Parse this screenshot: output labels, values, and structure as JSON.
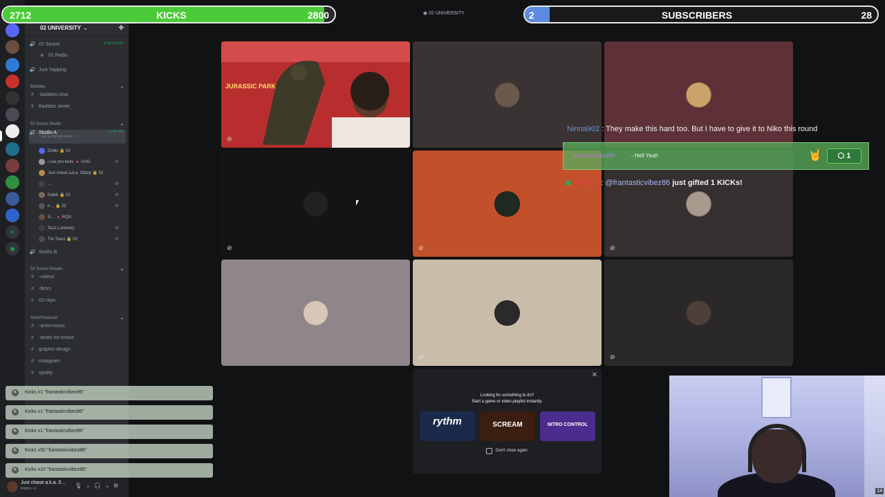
{
  "goals": {
    "kicks": {
      "current": "2712",
      "label": "KICKS",
      "target": "2800",
      "progress": 0.969,
      "color": "#4ccb3a"
    },
    "subscribers": {
      "current": "2",
      "label": "SUBSCRIBERS",
      "target": "28",
      "progress": 0.071,
      "color": "#5b8ae0"
    }
  },
  "window_title": "02 UNIVERSITY",
  "server": {
    "name": "02 UNIVERSITY",
    "channels": [
      {
        "label": "02 Sound",
        "time": "1:92:53:08"
      },
      {
        "label": "02 Radio"
      },
      {
        "label": "Just Yapping"
      }
    ],
    "categories": {
      "baddies": "Baddies",
      "studio": "02 Sound Studio",
      "visuals": "02 Sound Visuals",
      "artist": "Artist/Producer"
    },
    "baddies_channels": [
      "-baddies-chat",
      "Baddies street"
    ],
    "studio_a": {
      "label": "Studio A",
      "time": "1:47:04",
      "status": "Set a channel status"
    },
    "voice_users": [
      "Drells 🔒 02",
      "i use pro tools 🔺 UUG",
      "Just chase a.k.a. 02boy 🔒 02",
      "…",
      "Kaleb 🔒 02",
      "n… 🔒 02",
      "S… 🔺 RQG",
      "Tezz.Luminary",
      "Tre Trenz 🔒 02"
    ],
    "studio_b": "Studio B",
    "visual_channels": [
      "-videos",
      "-flicks",
      "02-clips"
    ],
    "artist_channels": [
      "-artist-music",
      "-beats-for-chase",
      "graphic-design",
      "instagram",
      "spotify"
    ]
  },
  "user_panel": {
    "name": "Just chase a.k.a. 0…",
    "status": "Roblox +1"
  },
  "kick_notifications": [
    "Kicks x1 \"frantasticvibez86\"",
    "Kicks x1 \"frantasticvibez86\"",
    "Kicks x1 \"frantasticvibez86\"",
    "Kicks x50 \"frantasticvibez86\"",
    "Kicks x10 \"frantasticvibez86\""
  ],
  "tiles": [
    {
      "bg": "#c33a3a",
      "scene": "JURASSIC PARK"
    },
    {
      "bg": "#3a3334"
    },
    {
      "bg": "#5d3137"
    },
    {
      "bg": "#141414"
    },
    {
      "bg": "#c2502a"
    },
    {
      "bg": "#35302f"
    },
    {
      "bg": "#8f858b"
    },
    {
      "bg": "#c9bca9"
    },
    {
      "bg": "#2b2829"
    }
  ],
  "chat": {
    "line1_user": "Ninna902",
    "line1_text": " : They make this hard too. But I have to give it to Niko this round",
    "highlight_user": "frantasticvibez86",
    "highlight_text": "- Hell Yeah",
    "highlight_count": "1",
    "line2_bot": "KickBot",
    "line2_user": "@frantasticvibez86",
    "line2_text": "just gifted 1 KICKs!"
  },
  "activity": {
    "title": "Looking for something to do?",
    "subtitle": "Start a game or video playlist instantly.",
    "cards": [
      {
        "label": "rythm",
        "bg": "#1b2a4a"
      },
      {
        "label": "SCREAM",
        "bg": "#3b1e10"
      },
      {
        "label": "NITRO CONTROL",
        "bg": "#4a2d8c"
      }
    ],
    "dont_show": "Don't show again"
  },
  "webcam_badge": "14"
}
